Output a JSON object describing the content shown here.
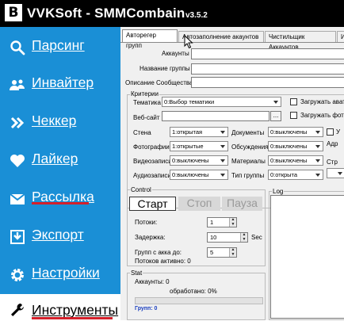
{
  "app": {
    "logo_letter": "B",
    "title": "VVKSoft - SMMCombain",
    "version": "v3.5.2"
  },
  "colors": {
    "sidebar": "#1a8fd6",
    "titlebar": "#000000",
    "underline_accent": "#d4202b"
  },
  "sidebar": {
    "items": [
      {
        "icon": "search-icon",
        "label": "Парсинг"
      },
      {
        "icon": "add-user-icon",
        "label": "Инвайтер"
      },
      {
        "icon": "chevrons-right-icon",
        "label": "Чеккер"
      },
      {
        "icon": "heart-icon",
        "label": "Лайкер"
      },
      {
        "icon": "envelope-icon",
        "label": "Рассылка"
      },
      {
        "icon": "export-icon",
        "label": "Экспорт"
      },
      {
        "icon": "gear-icon",
        "label": "Настройки"
      },
      {
        "icon": "wrench-icon",
        "label": "Инструменты",
        "active": true
      }
    ]
  },
  "tabs": [
    "Авторегер групп",
    "Автозаполнение акаунтов",
    "Чистильщик Аккаунтов",
    "И"
  ],
  "form": {
    "accounts_label": "Аккаунты",
    "group_name_label": "Название группы",
    "community_desc_label": "Описание Сообщества",
    "criteria_title": "Критерии",
    "theme_label": "Тематика",
    "theme_value": "0:Выбор тематики",
    "website_label": "Веб-сайт",
    "browse_button": "...",
    "load_avatar_label": "Загружать ават",
    "load_photo_label": "Загружать фото",
    "wall_label": "Стена",
    "wall_value": "1:открытая",
    "photos_label": "Фотографии",
    "photos_value": "1:открытые",
    "videos_label": "Видеозаписи",
    "videos_value": "0:выключены",
    "audio_label": "Аудиозаписи",
    "audio_value": "0:выключены",
    "docs_label": "Документы",
    "docs_value": "0:выключены",
    "discussions_label": "Обсуждения",
    "discussions_value": "0:выключены",
    "materials_label": "Материалы",
    "materials_value": "0:выключены",
    "group_type_label": "Тип группы",
    "group_type_value": "0:открыта",
    "right_cb_label": "У",
    "right_addr_label": "Адр",
    "right_str_label": "Стр"
  },
  "control": {
    "title": "Control",
    "start": "Старт",
    "stop": "Стоп",
    "pause": "Пауза",
    "threads_label": "Потоки:",
    "threads_value": "1",
    "delay_label": "Задержка:",
    "delay_value": "10",
    "delay_unit": "Sec",
    "groups_per_acc_label": "Групп с акка до:",
    "groups_per_acc_value": "5",
    "active_threads": "Потоков активно: 0"
  },
  "log": {
    "title": "Log"
  },
  "stat": {
    "title": "Stat",
    "accounts": "Аккаунты: 0",
    "processed": "обработано: 0%",
    "groups": "Групп: 0",
    "progress": 0
  }
}
